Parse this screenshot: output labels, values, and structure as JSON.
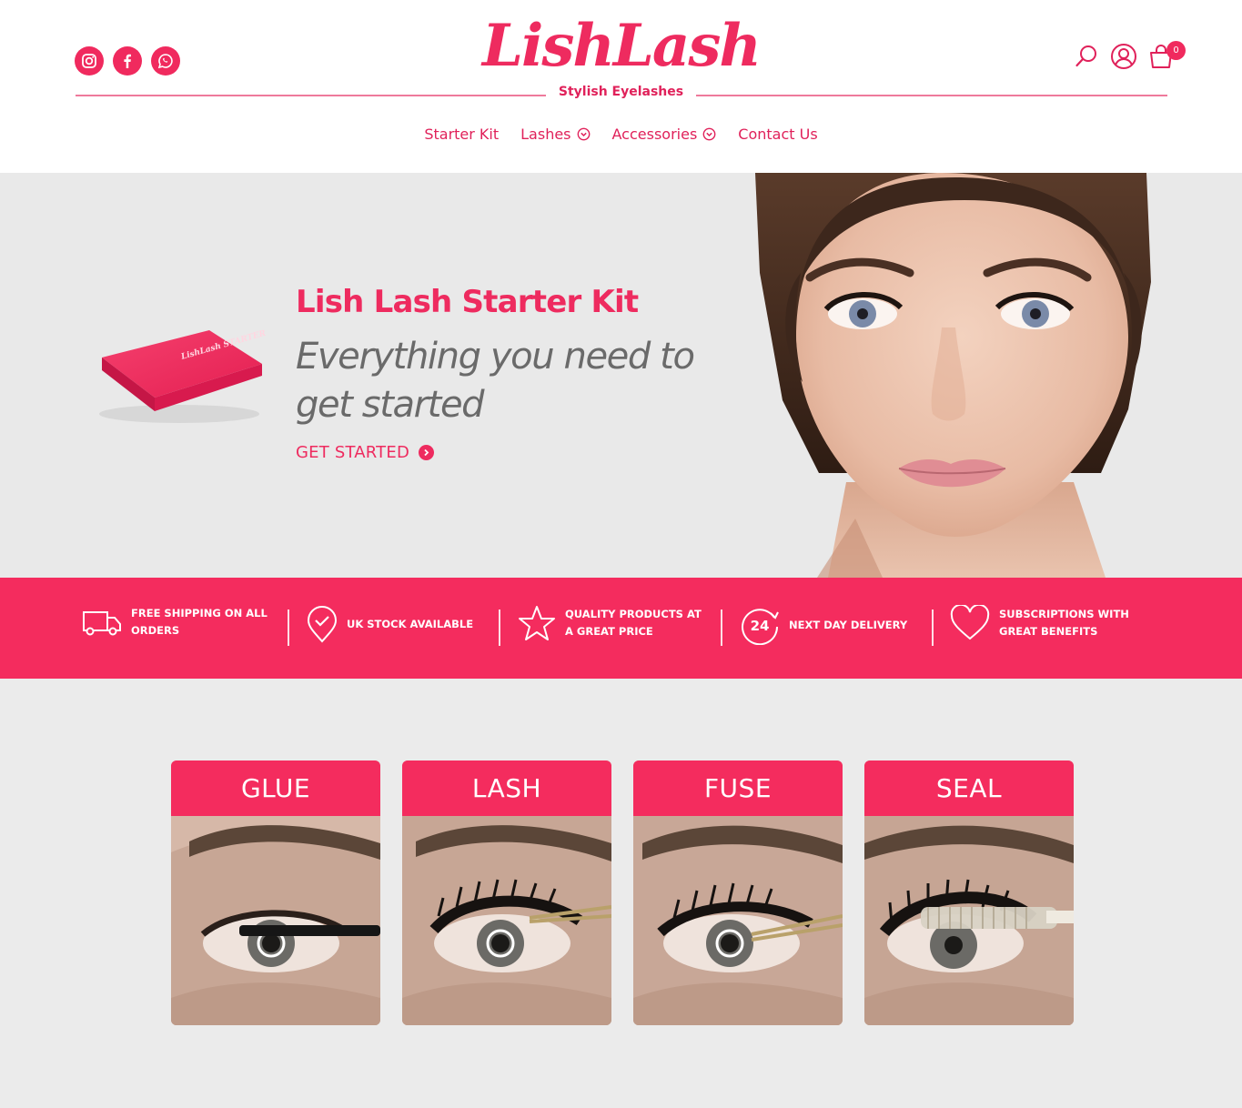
{
  "brand": {
    "logo_text": "LishLash",
    "tagline": "Stylish Eyelashes"
  },
  "social": [
    {
      "name": "instagram-icon"
    },
    {
      "name": "facebook-icon"
    },
    {
      "name": "whatsapp-icon"
    }
  ],
  "header_icons": {
    "cart_count": "0"
  },
  "nav": {
    "items": [
      {
        "label": "Starter Kit"
      },
      {
        "label": "Lashes"
      },
      {
        "label": "Accessories"
      },
      {
        "label": "Contact Us"
      }
    ]
  },
  "hero": {
    "box_text": "LishLash STARTER PACK",
    "title": "Lish Lash Starter Kit",
    "subtitle": "Everything you need to get started",
    "cta": "GET STARTED"
  },
  "benefits": [
    {
      "text": "FREE SHIPPING ON ALL ORDERS",
      "icon": "truck-icon"
    },
    {
      "text": "UK STOCK AVAILABLE",
      "icon": "check-badge-icon"
    },
    {
      "text": "QUALITY PRODUCTS AT A GREAT PRICE",
      "icon": "star-icon"
    },
    {
      "text": "NEXT DAY DELIVERY",
      "icon": "24-hour-icon",
      "icon_text": "24"
    },
    {
      "text": "SUBSCRIPTIONS WITH GREAT BENEFITS",
      "icon": "heart-icon"
    }
  ],
  "steps": [
    {
      "label": "GLUE"
    },
    {
      "label": "LASH"
    },
    {
      "label": "FUSE"
    },
    {
      "label": "SEAL"
    }
  ],
  "colors": {
    "brand_pink": "#f42c5e",
    "text_gray": "#6a6a6a",
    "background": "#ebebeb"
  }
}
